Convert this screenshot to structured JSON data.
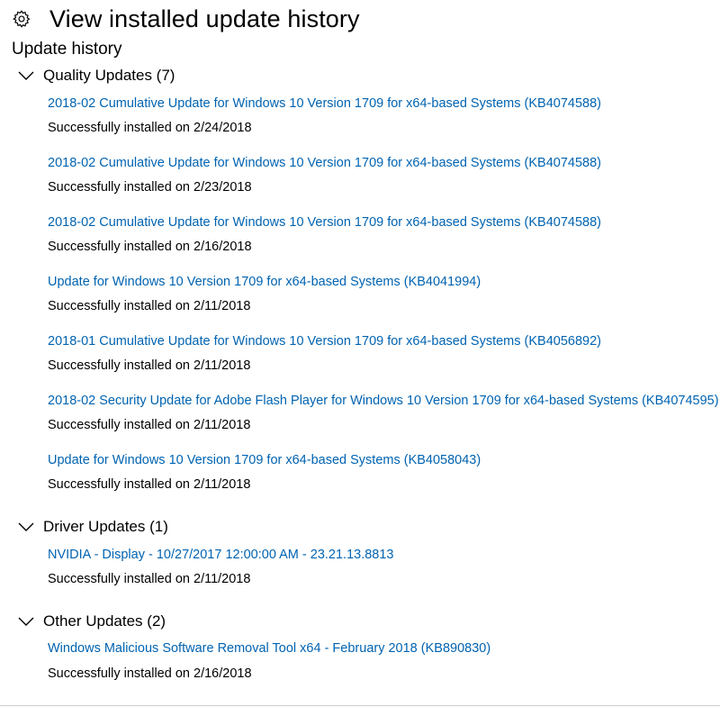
{
  "header": {
    "title": "View installed update history",
    "icon": "gear-icon"
  },
  "subtitle": "Update history",
  "colors": {
    "link": "#0063b1",
    "text": "#000000",
    "background": "#ffffff"
  },
  "groups": [
    {
      "label": "Quality Updates (7)",
      "expanded": true,
      "items": [
        {
          "name": "2018-02 Cumulative Update for Windows 10 Version 1709 for x64-based Systems (KB4074588)",
          "status": "Successfully installed on 2/24/2018"
        },
        {
          "name": "2018-02 Cumulative Update for Windows 10 Version 1709 for x64-based Systems (KB4074588)",
          "status": "Successfully installed on 2/23/2018"
        },
        {
          "name": "2018-02 Cumulative Update for Windows 10 Version 1709 for x64-based Systems (KB4074588)",
          "status": "Successfully installed on 2/16/2018"
        },
        {
          "name": "Update for Windows 10 Version 1709 for x64-based Systems (KB4041994)",
          "status": "Successfully installed on 2/11/2018"
        },
        {
          "name": "2018-01 Cumulative Update for Windows 10 Version 1709 for x64-based Systems (KB4056892)",
          "status": "Successfully installed on 2/11/2018"
        },
        {
          "name": "2018-02 Security Update for Adobe Flash Player for Windows 10 Version 1709 for x64-based Systems (KB4074595)",
          "status": "Successfully installed on 2/11/2018"
        },
        {
          "name": "Update for Windows 10 Version 1709 for x64-based Systems (KB4058043)",
          "status": "Successfully installed on 2/11/2018"
        }
      ]
    },
    {
      "label": "Driver Updates (1)",
      "expanded": true,
      "items": [
        {
          "name": "NVIDIA - Display - 10/27/2017 12:00:00 AM - 23.21.13.8813",
          "status": "Successfully installed on 2/11/2018"
        }
      ]
    },
    {
      "label": "Other Updates (2)",
      "expanded": true,
      "items": [
        {
          "name": "Windows Malicious Software Removal Tool x64 - February 2018 (KB890830)",
          "status": "Successfully installed on 2/16/2018"
        }
      ]
    }
  ]
}
